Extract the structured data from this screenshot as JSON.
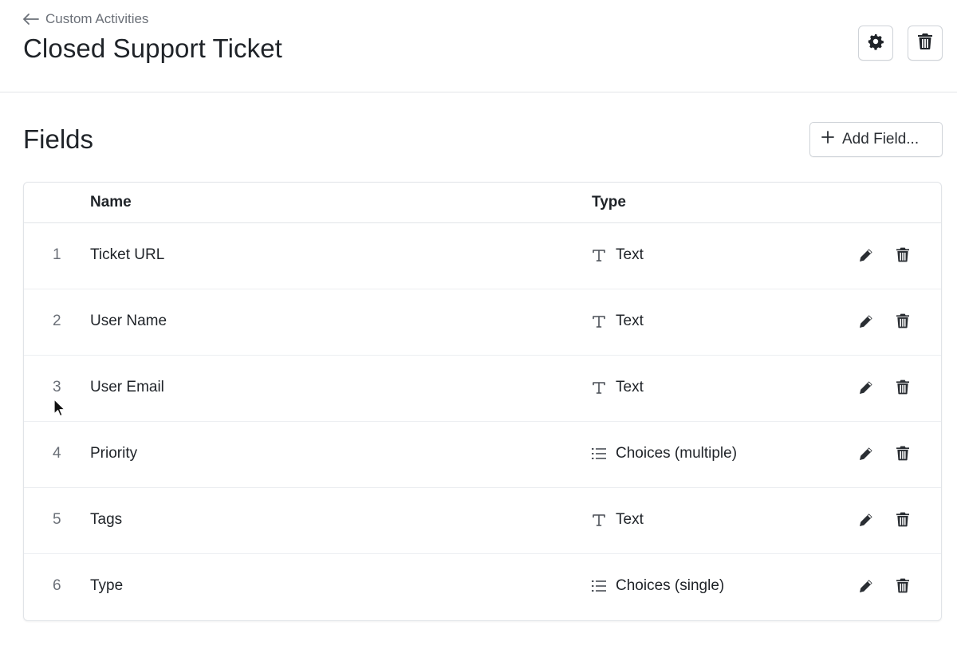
{
  "header": {
    "breadcrumb": "Custom Activities",
    "title": "Closed Support Ticket"
  },
  "fields_section": {
    "title": "Fields",
    "add_button_label": "Add Field..."
  },
  "table": {
    "columns": {
      "name": "Name",
      "type": "Type"
    },
    "rows": [
      {
        "index": "1",
        "name": "Ticket URL",
        "type": "Text",
        "type_icon": "text-type-icon"
      },
      {
        "index": "2",
        "name": "User Name",
        "type": "Text",
        "type_icon": "text-type-icon"
      },
      {
        "index": "3",
        "name": "User Email",
        "type": "Text",
        "type_icon": "text-type-icon"
      },
      {
        "index": "4",
        "name": "Priority",
        "type": "Choices (multiple)",
        "type_icon": "list-type-icon"
      },
      {
        "index": "5",
        "name": "Tags",
        "type": "Text",
        "type_icon": "text-type-icon"
      },
      {
        "index": "6",
        "name": "Type",
        "type": "Choices (single)",
        "type_icon": "list-type-icon"
      }
    ]
  },
  "colors": {
    "text": "#1f2328",
    "muted": "#6b7078",
    "border": "#e1e4e8",
    "icon": "#2a2e33"
  }
}
